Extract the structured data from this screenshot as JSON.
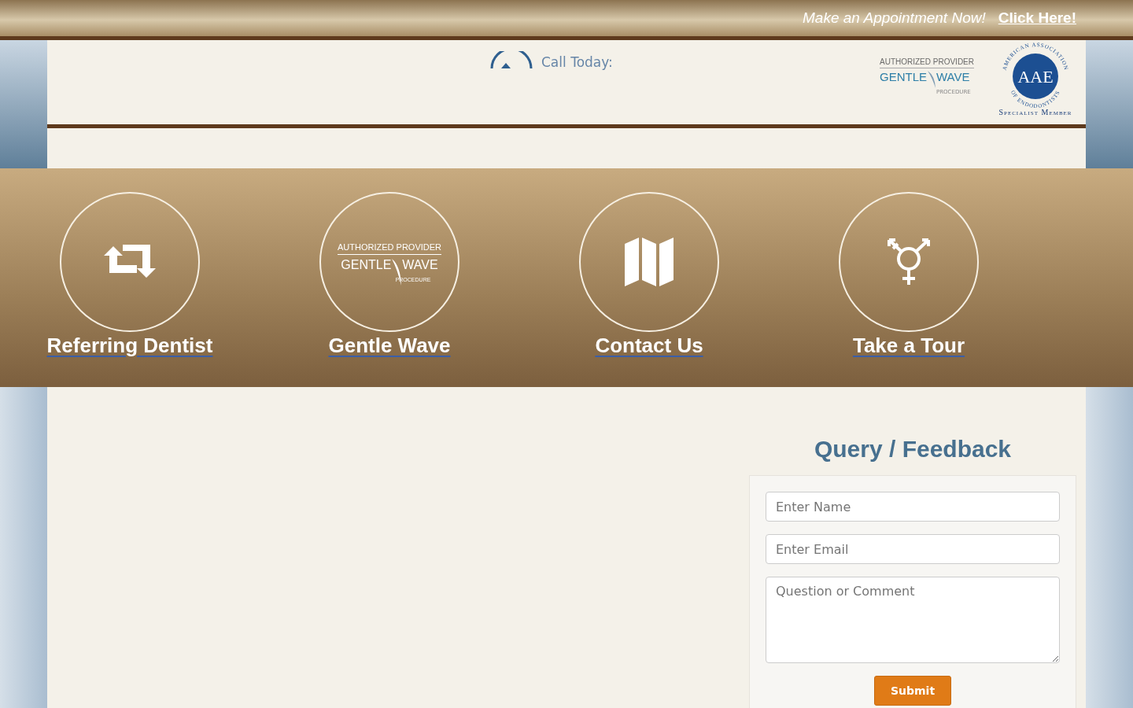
{
  "top_bar": {
    "text": "Make an Appointment Now!",
    "link": "Click Here!"
  },
  "header": {
    "call": "Call Today:",
    "provider_logo": {
      "top": "AUTHORIZED PROVIDER",
      "left": "GENTLE",
      "right": "WAVE",
      "sub": "PROCEDURE"
    },
    "aae_logo": {
      "letters": "AAE",
      "ring_top": "AMERICAN ASSOCIATION",
      "ring_bottom": "OF ENDODONTISTS",
      "caption": "Specialist Member"
    }
  },
  "features": [
    {
      "kind": "arrows",
      "label": "Referring Dentist"
    },
    {
      "kind": "provider",
      "label": "Gentle Wave",
      "logo": {
        "top": "AUTHORIZED PROVIDER",
        "left": "GENTLE",
        "right": "WAVE",
        "sub": "PROCEDURE"
      }
    },
    {
      "kind": "map",
      "label": "Contact Us"
    },
    {
      "kind": "symbol",
      "label": "Take a Tour"
    }
  ],
  "form": {
    "title": "Query / Feedback",
    "fields": [
      {
        "kind": "input",
        "placeholder": "Enter Name"
      },
      {
        "kind": "input",
        "placeholder": "Enter Email"
      },
      {
        "kind": "textarea",
        "placeholder": "Question or Comment"
      }
    ],
    "submit": "Submit"
  }
}
